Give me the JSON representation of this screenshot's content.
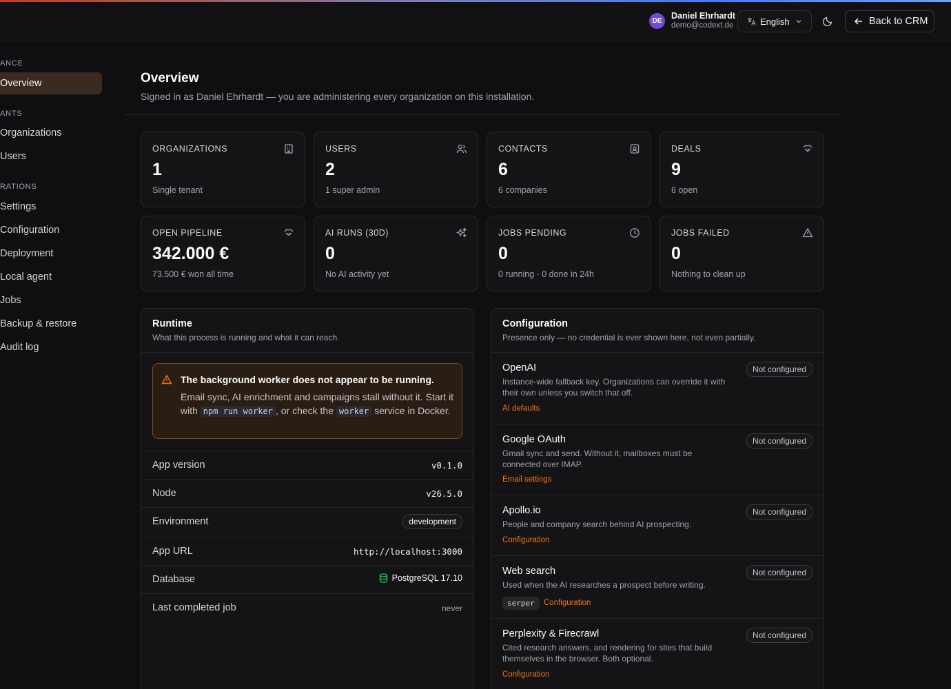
{
  "header": {
    "avatar_initials": "DE",
    "user_name": "Daniel Ehrhardt",
    "user_email": "demo@codext.de",
    "language_label": "English",
    "back_label": "Back to CRM"
  },
  "sidebar": {
    "sections": [
      {
        "label": "ANCE",
        "items": [
          {
            "label": "Overview",
            "active": true
          }
        ]
      },
      {
        "label": "ANTS",
        "items": [
          {
            "label": "Organizations"
          },
          {
            "label": "Users"
          }
        ]
      },
      {
        "label": "RATIONS",
        "items": [
          {
            "label": "Settings"
          },
          {
            "label": "Configuration"
          },
          {
            "label": "Deployment"
          },
          {
            "label": "Local agent"
          },
          {
            "label": "Jobs"
          },
          {
            "label": "Backup & restore"
          },
          {
            "label": "Audit log"
          }
        ]
      }
    ]
  },
  "page": {
    "title": "Overview",
    "subtitle": "Signed in as Daniel Ehrhardt — you are administering every organization on this installation."
  },
  "stats": [
    {
      "label": "ORGANIZATIONS",
      "value": "1",
      "sub": "Single tenant",
      "icon": "building-icon"
    },
    {
      "label": "USERS",
      "value": "2",
      "sub": "1 super admin",
      "icon": "users-icon"
    },
    {
      "label": "CONTACTS",
      "value": "6",
      "sub": "6 companies",
      "icon": "contact-icon"
    },
    {
      "label": "DEALS",
      "value": "9",
      "sub": "6 open",
      "icon": "handshake-icon"
    },
    {
      "label": "OPEN PIPELINE",
      "value": "342.000 €",
      "sub": "73.500 € won all time",
      "icon": "handshake-icon"
    },
    {
      "label": "AI RUNS (30D)",
      "value": "0",
      "sub": "No AI activity yet",
      "icon": "sparkles-icon"
    },
    {
      "label": "JOBS PENDING",
      "value": "0",
      "sub": "0 running · 0 done in 24h",
      "icon": "clock-icon"
    },
    {
      "label": "JOBS FAILED",
      "value": "0",
      "sub": "Nothing to clean up",
      "icon": "alert-triangle-icon"
    }
  ],
  "runtime": {
    "title": "Runtime",
    "subtitle": "What this process is running and what it can reach.",
    "warning": {
      "title": "The background worker does not appear to be running.",
      "line1": "Email sync, AI enrichment and campaigns stall without it.",
      "start_text": "Start it with",
      "cmd": "npm run worker",
      "mid_text": ", or check the",
      "service": "worker",
      "end_text": "service in Docker."
    },
    "rows": [
      {
        "key": "App version",
        "value": "v0.1.0"
      },
      {
        "key": "Node",
        "value": "v26.5.0"
      },
      {
        "key": "Environment",
        "value": "development"
      },
      {
        "key": "App URL",
        "value": "http://localhost:3000"
      },
      {
        "key": "Database",
        "value": "PostgreSQL 17.10"
      },
      {
        "key": "Last completed job",
        "value": "never"
      }
    ]
  },
  "configuration": {
    "title": "Configuration",
    "subtitle": "Presence only — no credential is ever shown here, not even partially.",
    "items": [
      {
        "name": "OpenAI",
        "desc": "Instance-wide fallback key. Organizations can override it with their own unless you switch that off.",
        "status": "Not configured",
        "link": "AI defaults"
      },
      {
        "name": "Google OAuth",
        "desc": "Gmail sync and send. Without it, mailboxes must be connected over IMAP.",
        "status": "Not configured",
        "link": "Email settings"
      },
      {
        "name": "Apollo.io",
        "desc": "People and company search behind AI prospecting.",
        "status": "Not configured",
        "link": "Configuration"
      },
      {
        "name": "Web search",
        "desc": "Used when the AI researches a prospect before writing.",
        "status": "Not configured",
        "chip": "serper",
        "link": "Configuration"
      },
      {
        "name": "Perplexity & Firecrawl",
        "desc": "Cited research answers, and rendering for sites that build themselves in the browser. Both optional.",
        "status": "Not configured",
        "link": "Configuration"
      }
    ]
  },
  "colors": {
    "accent": "#f97316",
    "avatar": "#6d4bd8",
    "active_nav": "#3a2a1f",
    "warning_border": "#7c4a1c"
  }
}
